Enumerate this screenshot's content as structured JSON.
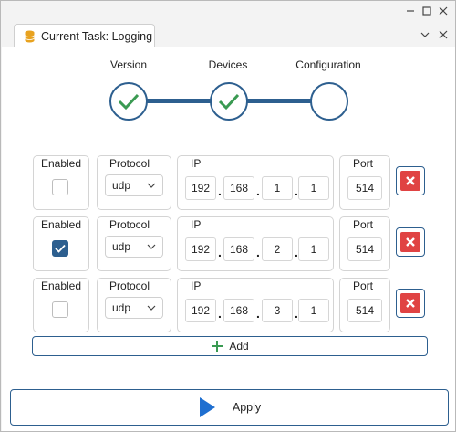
{
  "tab": {
    "title": "Current Task: Logging"
  },
  "steps": [
    {
      "label": "Version",
      "state": "done"
    },
    {
      "label": "Devices",
      "state": "done"
    },
    {
      "label": "Configuration",
      "state": "current"
    }
  ],
  "columns": {
    "enabled": "Enabled",
    "protocol": "Protocol",
    "ip": "IP",
    "port": "Port"
  },
  "rows": [
    {
      "enabled": false,
      "protocol": "udp",
      "ip": [
        "192",
        "168",
        "1",
        "1"
      ],
      "port": "514"
    },
    {
      "enabled": true,
      "protocol": "udp",
      "ip": [
        "192",
        "168",
        "2",
        "1"
      ],
      "port": "514"
    },
    {
      "enabled": false,
      "protocol": "udp",
      "ip": [
        "192",
        "168",
        "3",
        "1"
      ],
      "port": "514"
    }
  ],
  "buttons": {
    "add": "Add",
    "apply": "Apply"
  },
  "colors": {
    "accent": "#2d5f8f",
    "check_green": "#3a9a52",
    "delete_red": "#e04343"
  }
}
